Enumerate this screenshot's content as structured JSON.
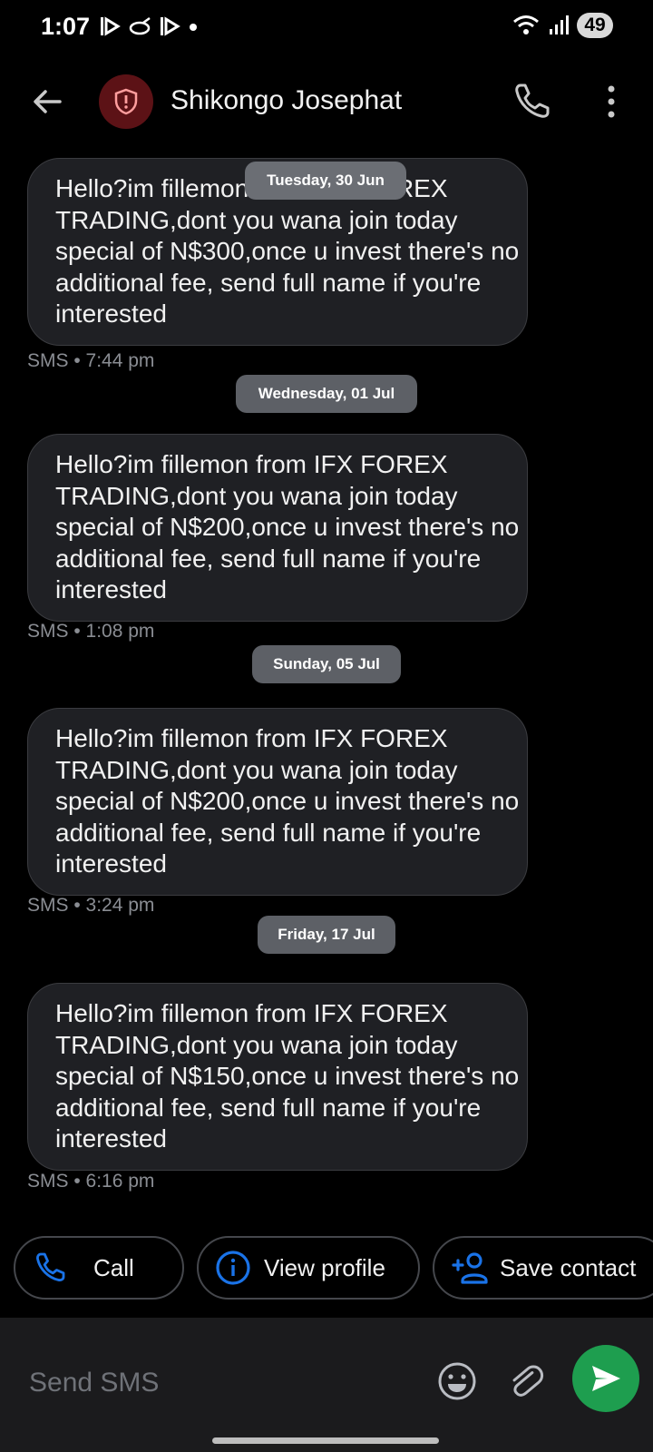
{
  "status": {
    "time": "1:07",
    "battery": "49"
  },
  "header": {
    "contact_name": "Shikongo Josephat"
  },
  "messages": [
    {
      "date": "Tuesday, 30 Jun",
      "text": "Hello?im fillemon from IFX FOREX TRADING,dont you wana join today special of N$300,once u invest there's no additional fee, send full name if you're interested",
      "meta": "SMS • 7:44 pm"
    },
    {
      "date": "Wednesday, 01 Jul",
      "text": "Hello?im fillemon from IFX FOREX TRADING,dont you wana join today special of N$200,once u invest there's no additional fee, send full name if you're interested",
      "meta": "SMS • 1:08 pm"
    },
    {
      "date": "Sunday, 05 Jul",
      "text": "Hello?im fillemon from IFX FOREX TRADING,dont you wana join today special of N$200,once u invest there's no additional fee, send full name if you're interested",
      "meta": "SMS • 3:24 pm"
    },
    {
      "date": "Friday, 17 Jul",
      "text": "Hello?im fillemon from IFX FOREX TRADING,dont you wana join today special of N$150,once u invest there's no additional fee, send full name if you're interested",
      "meta": "SMS • 6:16 pm"
    }
  ],
  "actions": {
    "call": "Call",
    "view_profile": "View profile",
    "save_contact": "Save contact"
  },
  "composer": {
    "placeholder": "Send SMS"
  },
  "colors": {
    "accent_blue": "#1a73e8",
    "send_green": "#1e9e4f",
    "shield_red": "#5c1216"
  },
  "icons": {
    "back": "arrow-left-icon",
    "avatar": "shield-icon",
    "call": "phone-icon",
    "more": "more-vert-icon",
    "view_profile": "info-icon",
    "save_contact": "person-add-icon",
    "emoji": "emoji-icon",
    "attach": "paperclip-icon",
    "send": "send-icon"
  }
}
